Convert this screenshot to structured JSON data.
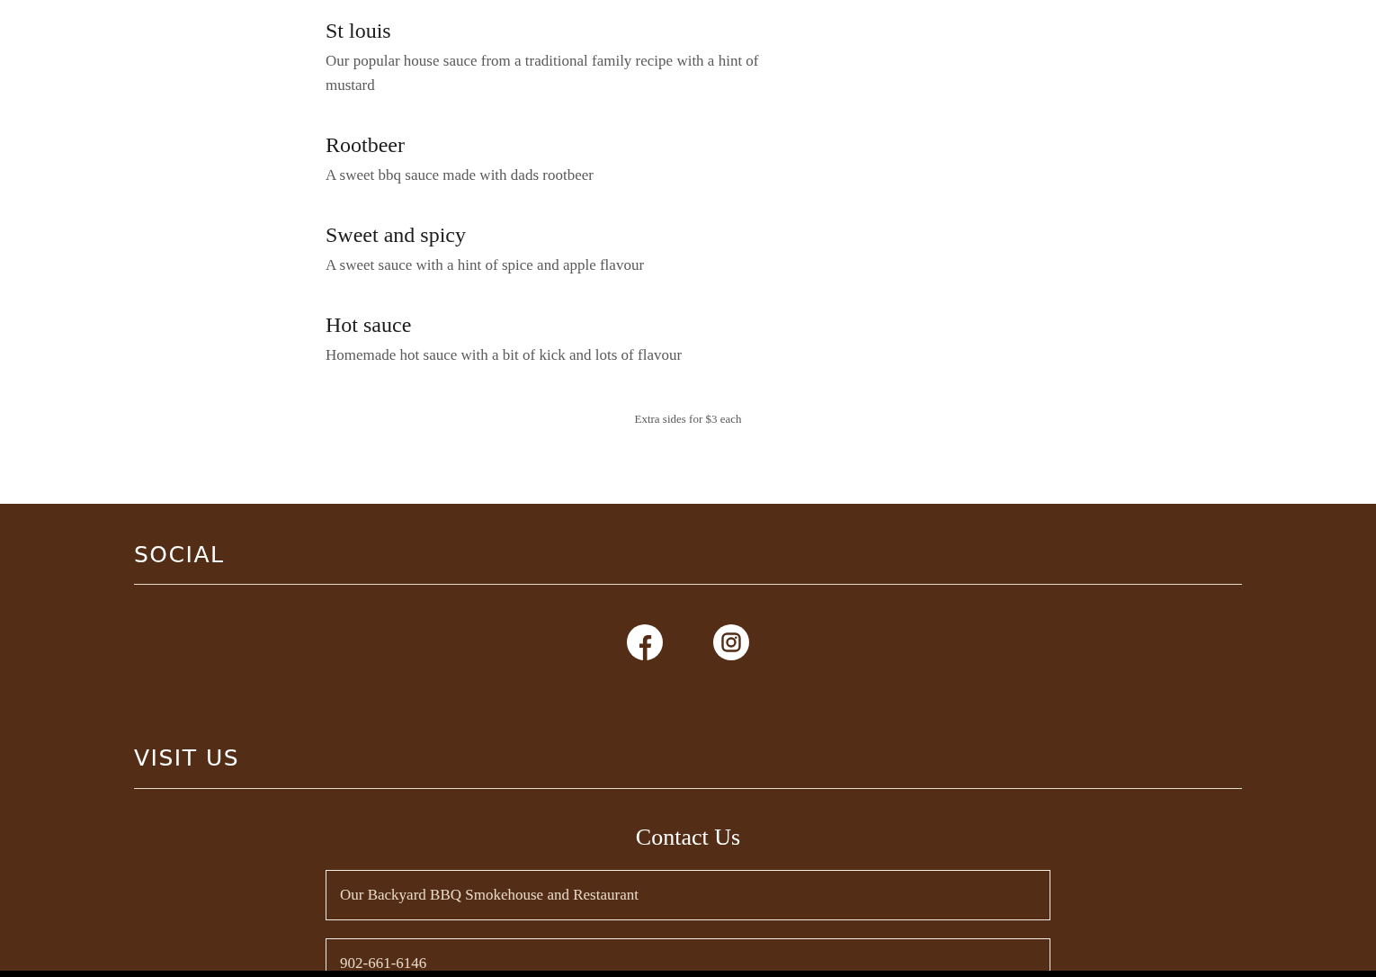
{
  "menu_items": [
    {
      "name": "St louis",
      "description": "Our popular house sauce from a traditional family recipe with a hint of mustard"
    },
    {
      "name": "Rootbeer",
      "description": "A sweet bbq sauce made with dads rootbeer"
    },
    {
      "name": "Sweet and spicy",
      "description": "A sweet sauce with a hint of spice and apple flavour"
    },
    {
      "name": "Hot sauce",
      "description": "Homemade hot sauce with a bit of kick and lots of flavour"
    }
  ],
  "note": "Extra sides for $3 each",
  "social": {
    "heading": "SOCIAL",
    "links": [
      {
        "kind": "facebook"
      },
      {
        "kind": "instagram"
      }
    ]
  },
  "visit": {
    "heading": "VISIT US",
    "contact_title": "Contact Us",
    "fields": [
      {
        "placeholder": "Our Backyard BBQ Smokehouse and Restaurant"
      },
      {
        "placeholder": "902-661-6146"
      }
    ]
  }
}
